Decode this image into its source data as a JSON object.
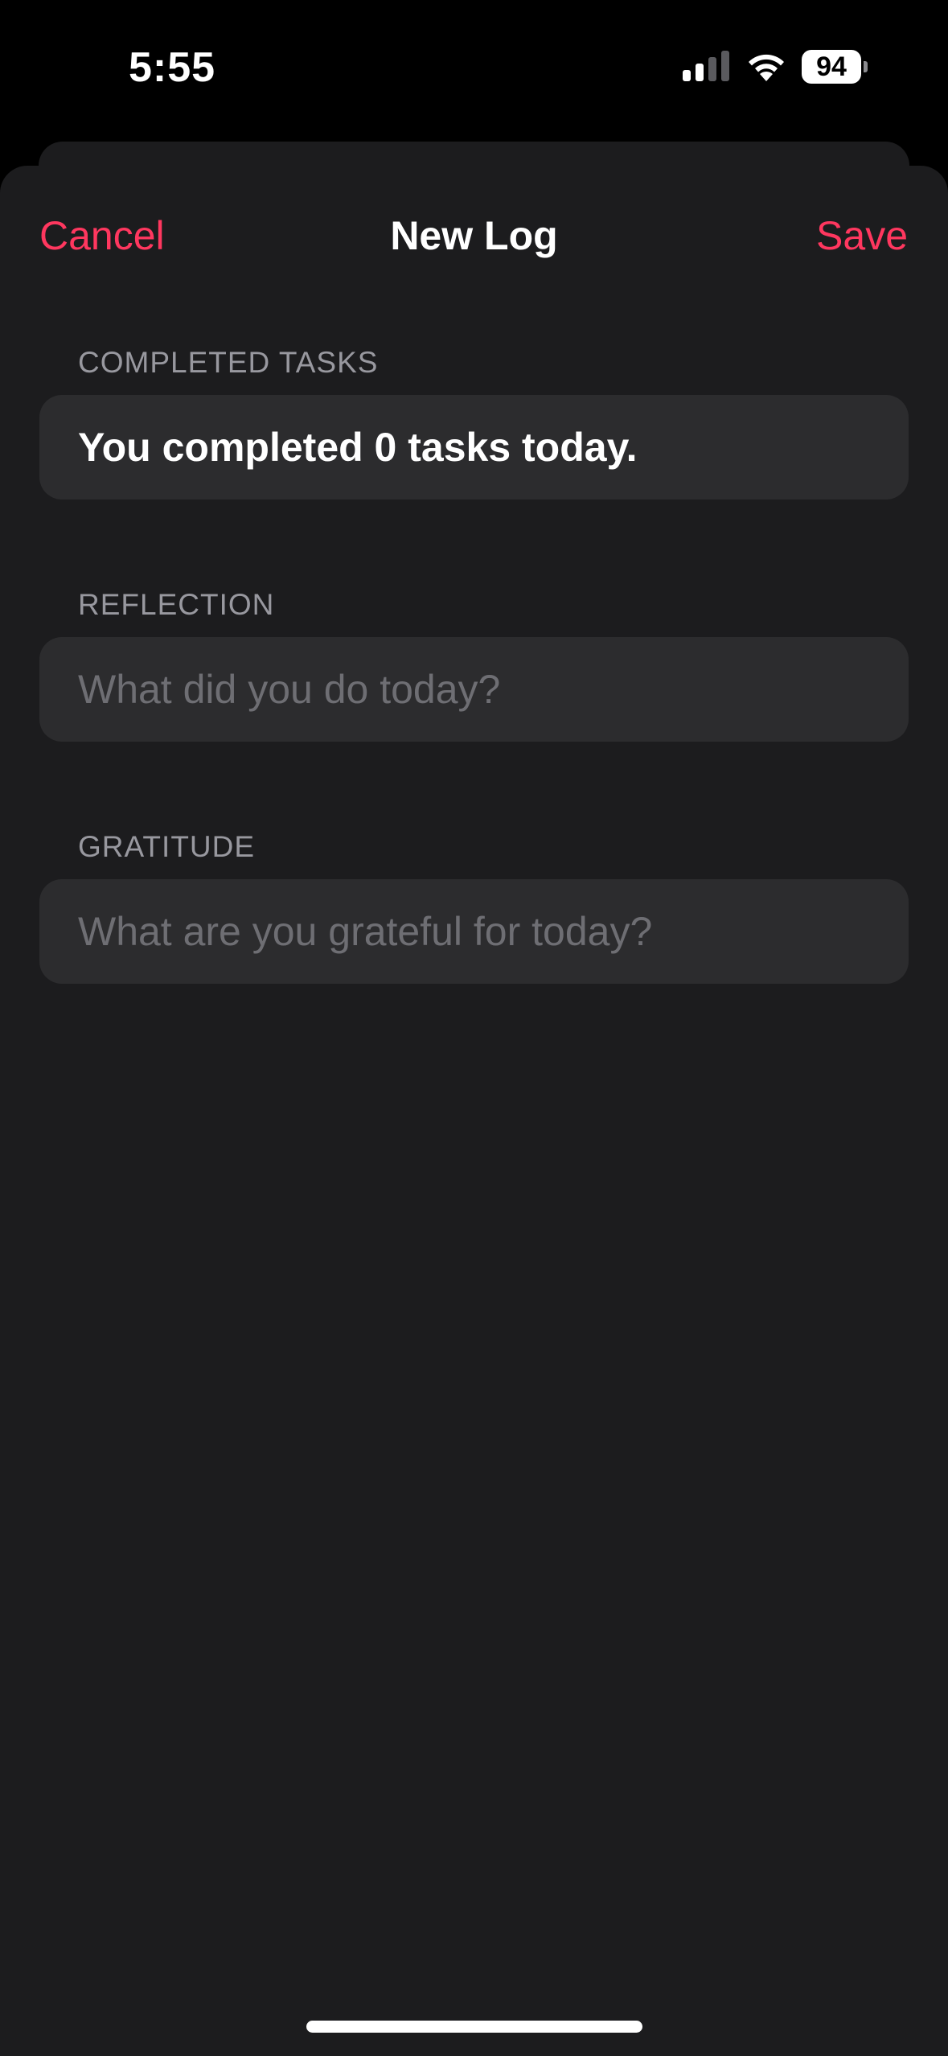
{
  "status_bar": {
    "time": "5:55",
    "battery_level": "94",
    "icons": [
      "signal-icon",
      "wifi-icon",
      "battery-icon"
    ]
  },
  "nav": {
    "cancel_label": "Cancel",
    "title": "New Log",
    "save_label": "Save"
  },
  "completed_tasks": {
    "header": "COMPLETED TASKS",
    "text": "You completed 0 tasks today."
  },
  "reflection": {
    "header": "REFLECTION",
    "placeholder": "What did you do today?",
    "value": ""
  },
  "gratitude": {
    "header": "GRATITUDE",
    "placeholder": "What are you grateful for today?",
    "value": ""
  },
  "colors": {
    "accent": "#ff375f",
    "sheet_background": "#1c1c1e",
    "field_background": "#2c2c2e",
    "section_header": "#98989f",
    "placeholder": "#6e6e73"
  }
}
